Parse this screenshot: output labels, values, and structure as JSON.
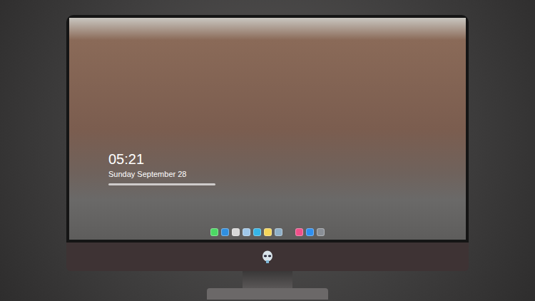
{
  "clock": {
    "time": "05:21",
    "date": "Sunday September 28"
  },
  "dock": {
    "apps": [
      {
        "color": "#4cd964"
      },
      {
        "color": "#2f8fe0"
      },
      {
        "color": "#d8d8d8"
      },
      {
        "color": "#9fc7e8"
      },
      {
        "color": "#35b6e8"
      },
      {
        "color": "#f5d55a"
      },
      {
        "color": "#8fb0c8"
      }
    ],
    "pinned": [
      {
        "color": "#f0508a"
      },
      {
        "color": "#2e8ff0"
      },
      {
        "color": "#8a8f96"
      }
    ]
  }
}
